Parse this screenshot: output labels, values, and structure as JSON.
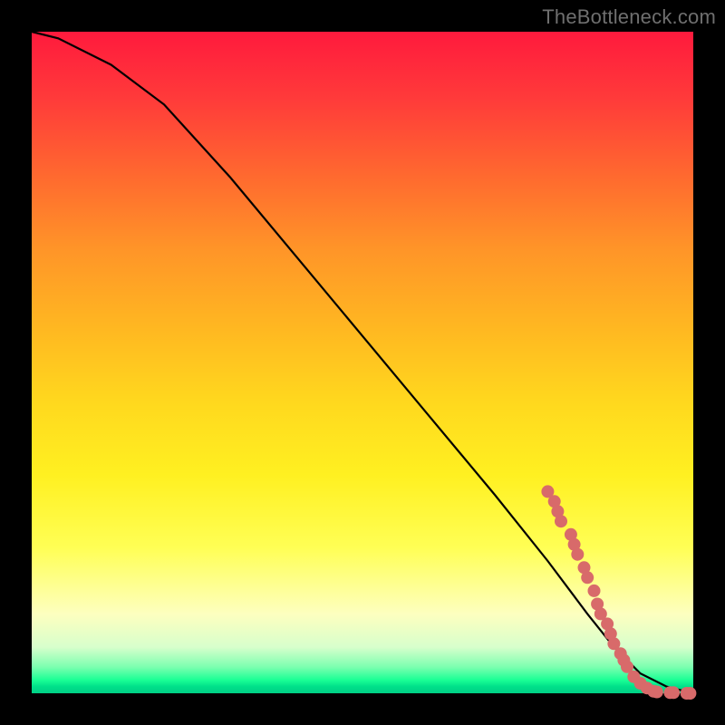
{
  "watermark": "TheBottleneck.com",
  "chart_data": {
    "type": "line",
    "title": "",
    "xlabel": "",
    "ylabel": "",
    "xlim": [
      0,
      100
    ],
    "ylim": [
      0,
      100
    ],
    "grid": false,
    "series": [
      {
        "name": "curve",
        "color": "#000000",
        "x": [
          0,
          4,
          8,
          12,
          16,
          20,
          30,
          40,
          50,
          60,
          70,
          78,
          84,
          88,
          92,
          96,
          100
        ],
        "y": [
          100,
          99,
          97,
          95,
          92,
          89,
          78,
          66,
          54,
          42,
          30,
          20,
          12,
          7,
          3,
          1,
          0
        ]
      }
    ],
    "scatter": {
      "name": "dots",
      "color": "#d86a6a",
      "radius_px": 7,
      "points": [
        {
          "x": 78.0,
          "y": 30.5
        },
        {
          "x": 79.0,
          "y": 29.0
        },
        {
          "x": 79.5,
          "y": 27.5
        },
        {
          "x": 80.0,
          "y": 26.0
        },
        {
          "x": 81.5,
          "y": 24.0
        },
        {
          "x": 82.0,
          "y": 22.5
        },
        {
          "x": 82.5,
          "y": 21.0
        },
        {
          "x": 83.5,
          "y": 19.0
        },
        {
          "x": 84.0,
          "y": 17.5
        },
        {
          "x": 85.0,
          "y": 15.5
        },
        {
          "x": 85.5,
          "y": 13.5
        },
        {
          "x": 86.0,
          "y": 12.0
        },
        {
          "x": 87.0,
          "y": 10.5
        },
        {
          "x": 87.5,
          "y": 9.0
        },
        {
          "x": 88.0,
          "y": 7.5
        },
        {
          "x": 89.0,
          "y": 6.0
        },
        {
          "x": 89.5,
          "y": 5.0
        },
        {
          "x": 90.0,
          "y": 4.0
        },
        {
          "x": 91.0,
          "y": 2.5
        },
        {
          "x": 92.0,
          "y": 1.5
        },
        {
          "x": 93.0,
          "y": 0.8
        },
        {
          "x": 94.0,
          "y": 0.3
        },
        {
          "x": 94.5,
          "y": 0.2
        },
        {
          "x": 96.5,
          "y": 0.1
        },
        {
          "x": 97.0,
          "y": 0.1
        },
        {
          "x": 99.0,
          "y": 0.0
        },
        {
          "x": 99.5,
          "y": 0.0
        }
      ]
    }
  }
}
